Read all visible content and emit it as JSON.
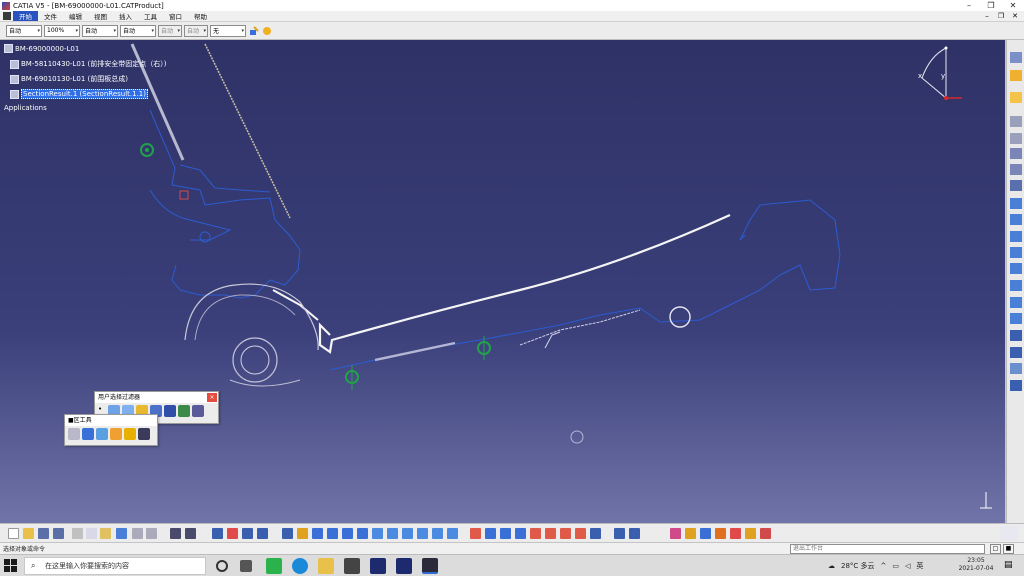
{
  "window": {
    "title": "CATIA V5 - [BM-69000000-L01.CATProduct]",
    "controls": [
      "–",
      "❐",
      "✕"
    ]
  },
  "menubar": {
    "items": [
      "开始",
      "文件",
      "编辑",
      "视图",
      "插入",
      "工具",
      "窗口",
      "帮助"
    ],
    "active_index": 0,
    "mdi_controls": [
      "–",
      "❐",
      "✕"
    ]
  },
  "propbar": {
    "combos": [
      "自动",
      "100%",
      "自动",
      "自动",
      "自动",
      "自动",
      "无"
    ]
  },
  "tree": {
    "root": "BM-69000000-L01",
    "children": [
      "BM-58110430-L01 (前排安全带固定点（右）)",
      "BM-69010130-L01 (前围板总成)",
      "SectionResult.1 (SectionResult.1.1)"
    ],
    "selected_index": 2,
    "applications": "Applications"
  },
  "user_selection_filter": {
    "title": "用户选择过滤器",
    "close": "×"
  },
  "small_toolbar": {
    "title": "■区工具"
  },
  "compass": {
    "x_label": "x",
    "y_label": "y"
  },
  "statusbar": {
    "message": "选择对象或命令",
    "command_placeholder": "退出工作台"
  },
  "taskbar": {
    "search_placeholder": "在这里输入你要搜索的内容",
    "weather": "28°C 多云",
    "ime": "英",
    "time": "23:05",
    "date": "2021-07-04"
  },
  "colors": {
    "viewport_top": "#2e3266",
    "viewport_bottom": "#7074a8",
    "section_curve": "#2c5cd0",
    "highlight_curve": "#ffffff",
    "marker_green": "#21a14a",
    "selection_blue": "#2f6ee6"
  }
}
